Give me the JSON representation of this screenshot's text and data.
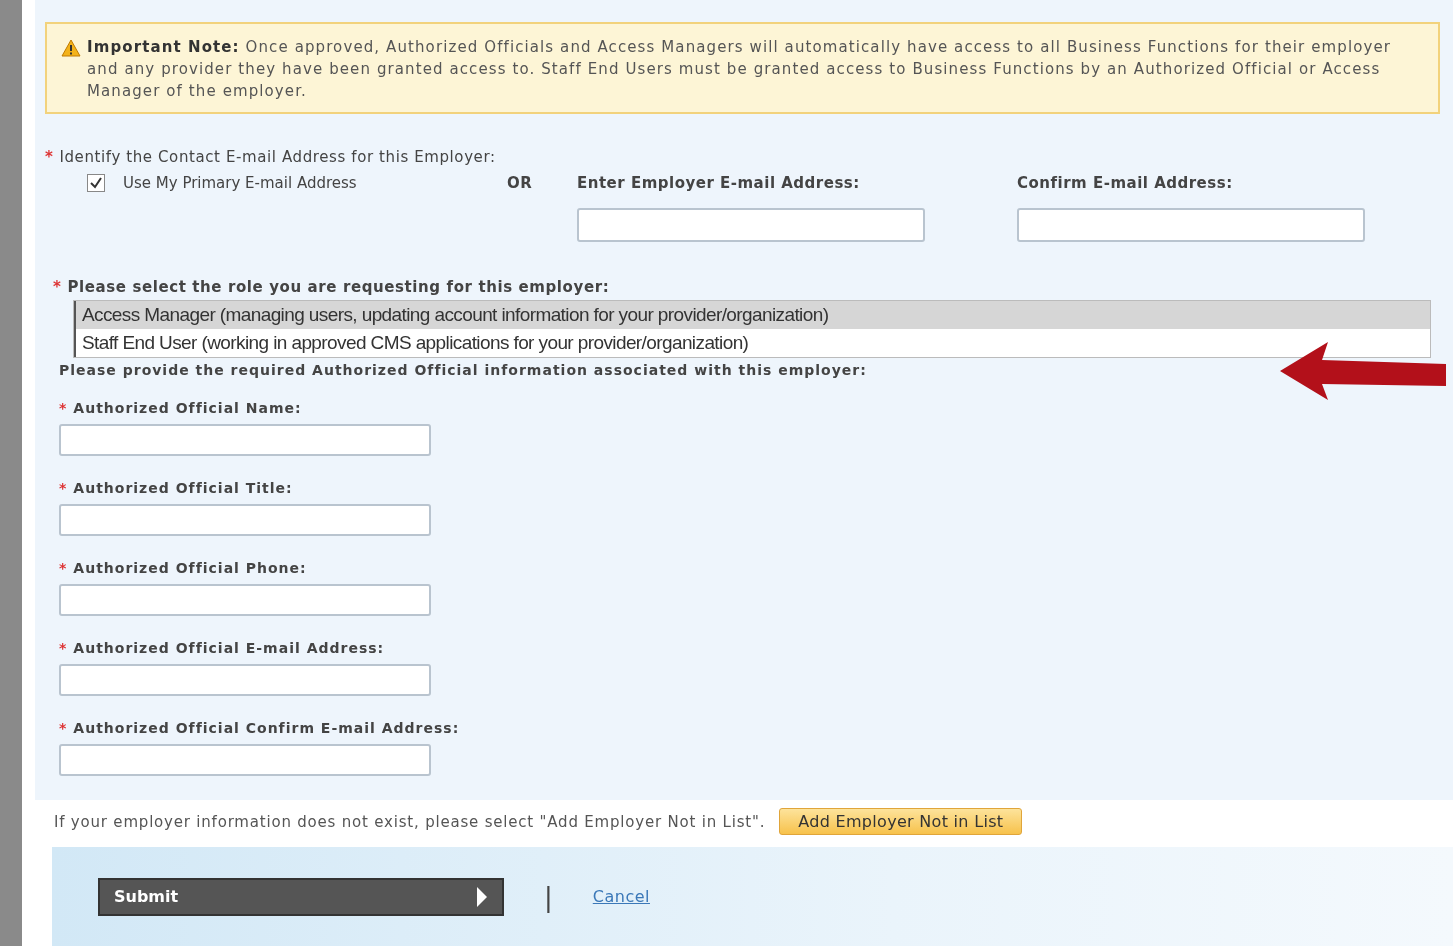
{
  "note": {
    "title": "Important Note:",
    "text": "Once approved, Authorized Officials and Access Managers will automatically have access to all Business Functions for their employer and any provider they have been granted access to. Staff End Users must be granted access to Business Functions by an Authorized Official or Access Manager of the employer."
  },
  "contact": {
    "required_mark": "*",
    "label": "Identify the Contact E-mail Address for this Employer:",
    "use_primary": {
      "label": "Use My Primary E-mail Address",
      "checked": true
    },
    "or": "OR",
    "employer_email": {
      "label": "Enter Employer E-mail Address:"
    },
    "confirm_email": {
      "label": "Confirm E-mail Address:"
    }
  },
  "role": {
    "required_mark": "*",
    "label": "Please select the role you are requesting for this employer:",
    "options": [
      {
        "label": "Access Manager (managing users, updating account information for your provider/organization)",
        "selected": true
      },
      {
        "label": "Staff End User (working in approved CMS applications for your provider/organization)",
        "selected": false
      }
    ]
  },
  "official": {
    "intro": "Please provide the required Authorized Official information associated with this employer:",
    "fields": [
      {
        "required_mark": "*",
        "label": "Authorized Official Name:"
      },
      {
        "required_mark": "*",
        "label": "Authorized Official Title:"
      },
      {
        "required_mark": "*",
        "label": "Authorized Official Phone:"
      },
      {
        "required_mark": "*",
        "label": "Authorized Official E-mail Address:"
      },
      {
        "required_mark": "*",
        "label": "Authorized Official Confirm E-mail Address:"
      }
    ]
  },
  "footer": {
    "text": "If your employer information does not exist, please select \"Add Employer Not in List\".",
    "add_button": "Add Employer Not in List"
  },
  "actions": {
    "submit": "Submit",
    "separator": "|",
    "cancel": "Cancel"
  }
}
